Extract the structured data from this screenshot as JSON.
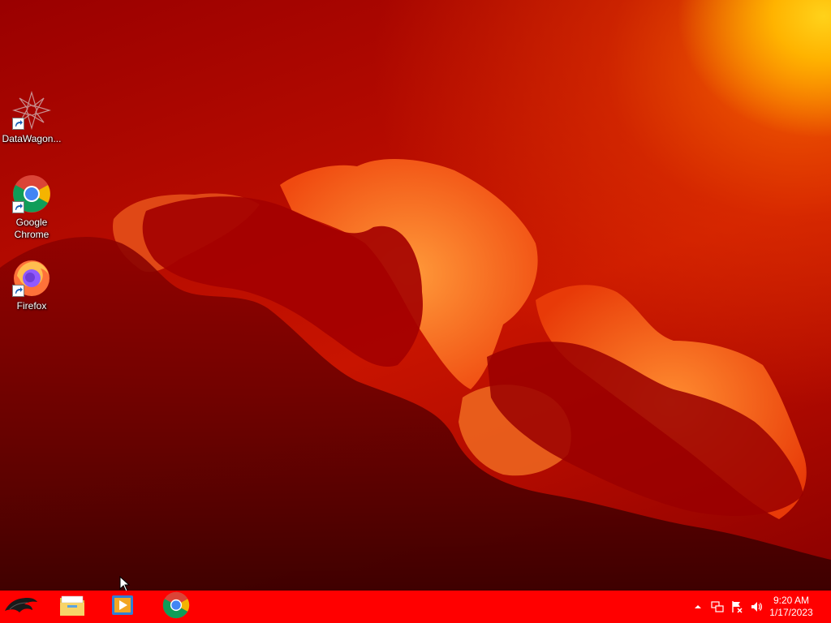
{
  "desktop": {
    "icons": [
      {
        "label": "DataWagon...",
        "icon": "datawagon-icon"
      },
      {
        "label": "Google Chrome",
        "icon": "chrome-icon"
      },
      {
        "label": "Firefox",
        "icon": "firefox-icon"
      }
    ]
  },
  "taskbar": {
    "start_icon": "rog-logo-icon",
    "pinned": [
      {
        "name": "File Explorer",
        "icon": "folder-icon"
      },
      {
        "name": "Media Player",
        "icon": "media-player-icon"
      },
      {
        "name": "Google Chrome",
        "icon": "chrome-icon"
      }
    ],
    "tray": {
      "icons": [
        "chevron-up-icon",
        "network-icon",
        "action-center-flag-icon",
        "volume-icon"
      ],
      "clock_time": "9:20 AM",
      "clock_date": "1/17/2023"
    },
    "color": "#ff0000"
  }
}
